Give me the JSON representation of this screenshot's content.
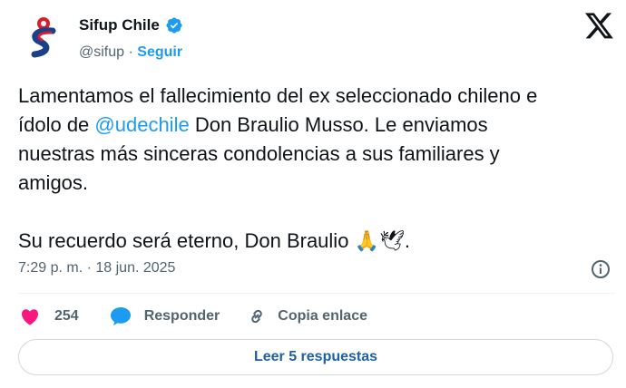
{
  "author": {
    "display_name": "Sifup Chile",
    "handle": "@sifup",
    "separator": "·",
    "follow_label": "Seguir"
  },
  "tweet": {
    "line1_before": "Lamentamos el fallecimiento del ex seleccionado chileno e",
    "line2_before": "ídolo de ",
    "mention": "@udechile",
    "line2_after": " Don Braulio Musso. Le enviamos",
    "line3": "nuestras más sinceras condolencias a sus familiares y",
    "line4": "amigos.",
    "line5_text": "Su recuerdo será eterno, Don Braulio ",
    "line5_emoji": "🙏🕊",
    "line5_end": ".",
    "timestamp": "7:29 p. m. · 18 jun. 2025"
  },
  "actions": {
    "like_count": "254",
    "reply_label": "Responder",
    "copy_label": "Copia enlace",
    "read_replies_label": "Leer 5 respuestas"
  },
  "icons": {
    "verified": "verified-badge-icon",
    "x_logo": "x-logo-icon",
    "info": "info-icon",
    "like": "heart-icon",
    "reply": "speech-bubble-icon",
    "copy": "link-icon"
  },
  "colors": {
    "accent": "#1d9bf0",
    "like": "#f91880",
    "text": "#0f1419",
    "muted": "#536471"
  }
}
